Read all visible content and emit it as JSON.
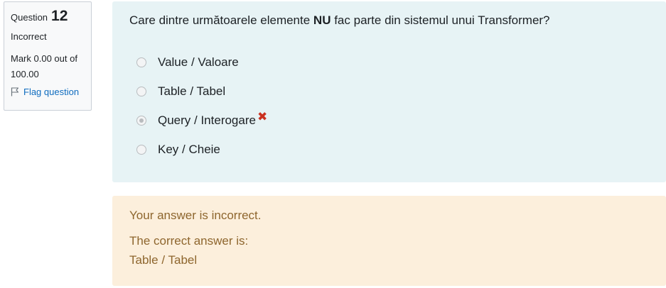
{
  "info": {
    "question_label": "Question",
    "question_number": "12",
    "state": "Incorrect",
    "grade": "Mark 0.00 out of 100.00",
    "flag_label": "Flag question"
  },
  "question": {
    "text_before": "Care dintre următoarele elemente ",
    "text_bold": "NU",
    "text_after": " fac parte din sistemul unui Transformer?",
    "answers": [
      {
        "label": "Value / Valoare",
        "checked": false
      },
      {
        "label": "Table / Tabel",
        "checked": false
      },
      {
        "label": "Query / Interogare",
        "checked": true,
        "marked_incorrect": true
      },
      {
        "label": "Key / Cheie",
        "checked": false
      }
    ],
    "incorrect_mark": "✖"
  },
  "feedback": {
    "result": "Your answer is incorrect.",
    "correct_intro": "The correct answer is:",
    "correct_answer": "Table / Tabel"
  },
  "colors": {
    "formulation_bg": "#e7f3f5",
    "feedback_bg": "#fcefdc",
    "feedback_text": "#8e662e",
    "link": "#0f6cbf",
    "incorrect": "#ca3120"
  }
}
